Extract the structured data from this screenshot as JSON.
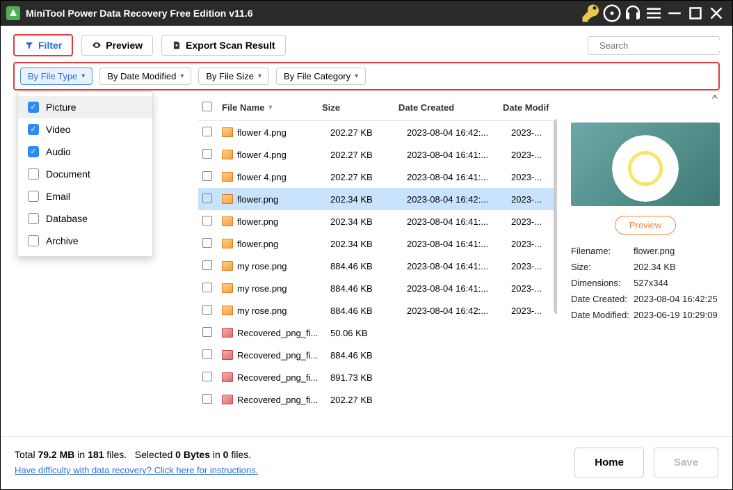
{
  "title": "MiniTool Power Data Recovery Free Edition v11.6",
  "toolbar": {
    "filter": "Filter",
    "preview": "Preview",
    "export": "Export Scan Result",
    "search_placeholder": "Search"
  },
  "filterbar": {
    "by_type": "By File Type",
    "by_date": "By Date Modified",
    "by_size": "By File Size",
    "by_category": "By File Category"
  },
  "type_dropdown": [
    {
      "label": "Picture",
      "checked": true
    },
    {
      "label": "Video",
      "checked": true
    },
    {
      "label": "Audio",
      "checked": true
    },
    {
      "label": "Document",
      "checked": false
    },
    {
      "label": "Email",
      "checked": false
    },
    {
      "label": "Database",
      "checked": false
    },
    {
      "label": "Archive",
      "checked": false
    }
  ],
  "columns": {
    "name": "File Name",
    "size": "Size",
    "date": "Date Created",
    "mod": "Date Modif"
  },
  "rows": [
    {
      "name": "flower 4.png",
      "size": "202.27 KB",
      "date": "2023-08-04 16:42:...",
      "mod": "2023-..."
    },
    {
      "name": "flower 4.png",
      "size": "202.27 KB",
      "date": "2023-08-04 16:41:...",
      "mod": "2023-..."
    },
    {
      "name": "flower 4.png",
      "size": "202.27 KB",
      "date": "2023-08-04 16:41:...",
      "mod": "2023-..."
    },
    {
      "name": "flower.png",
      "size": "202.34 KB",
      "date": "2023-08-04 16:42:...",
      "mod": "2023-...",
      "selected": true
    },
    {
      "name": "flower.png",
      "size": "202.34 KB",
      "date": "2023-08-04 16:41:...",
      "mod": "2023-..."
    },
    {
      "name": "flower.png",
      "size": "202.34 KB",
      "date": "2023-08-04 16:41:...",
      "mod": "2023-..."
    },
    {
      "name": "my rose.png",
      "size": "884.46 KB",
      "date": "2023-08-04 16:41:...",
      "mod": "2023-..."
    },
    {
      "name": "my rose.png",
      "size": "884.46 KB",
      "date": "2023-08-04 16:41:...",
      "mod": "2023-..."
    },
    {
      "name": "my rose.png",
      "size": "884.46 KB",
      "date": "2023-08-04 16:42:...",
      "mod": "2023-..."
    },
    {
      "name": "Recovered_png_fi...",
      "size": "50.06 KB",
      "date": "",
      "mod": "",
      "doc": true
    },
    {
      "name": "Recovered_png_fi...",
      "size": "884.46 KB",
      "date": "",
      "mod": "",
      "doc": true
    },
    {
      "name": "Recovered_png_fi...",
      "size": "891.73 KB",
      "date": "",
      "mod": "",
      "doc": true
    },
    {
      "name": "Recovered_png_fi...",
      "size": "202.27 KB",
      "date": "",
      "mod": "",
      "doc": true
    }
  ],
  "preview": {
    "button": "Preview",
    "labels": {
      "filename": "Filename:",
      "size": "Size:",
      "dimensions": "Dimensions:",
      "created": "Date Created:",
      "modified": "Date Modified:"
    },
    "filename": "flower.png",
    "size": "202.34 KB",
    "dimensions": "527x344",
    "created": "2023-08-04 16:42:25",
    "modified": "2023-06-19 10:29:09"
  },
  "status": {
    "total_prefix": "Total ",
    "total_mb": "79.2 MB",
    "in": " in ",
    "total_files": "181",
    "files_suffix": " files.",
    "sel_prefix": "Selected ",
    "sel_bytes": "0 Bytes",
    "in2": " in ",
    "sel_files": "0",
    "files_suffix2": " files.",
    "help_link": "Have difficulty with data recovery? Click here for instructions.",
    "home": "Home",
    "save": "Save"
  }
}
